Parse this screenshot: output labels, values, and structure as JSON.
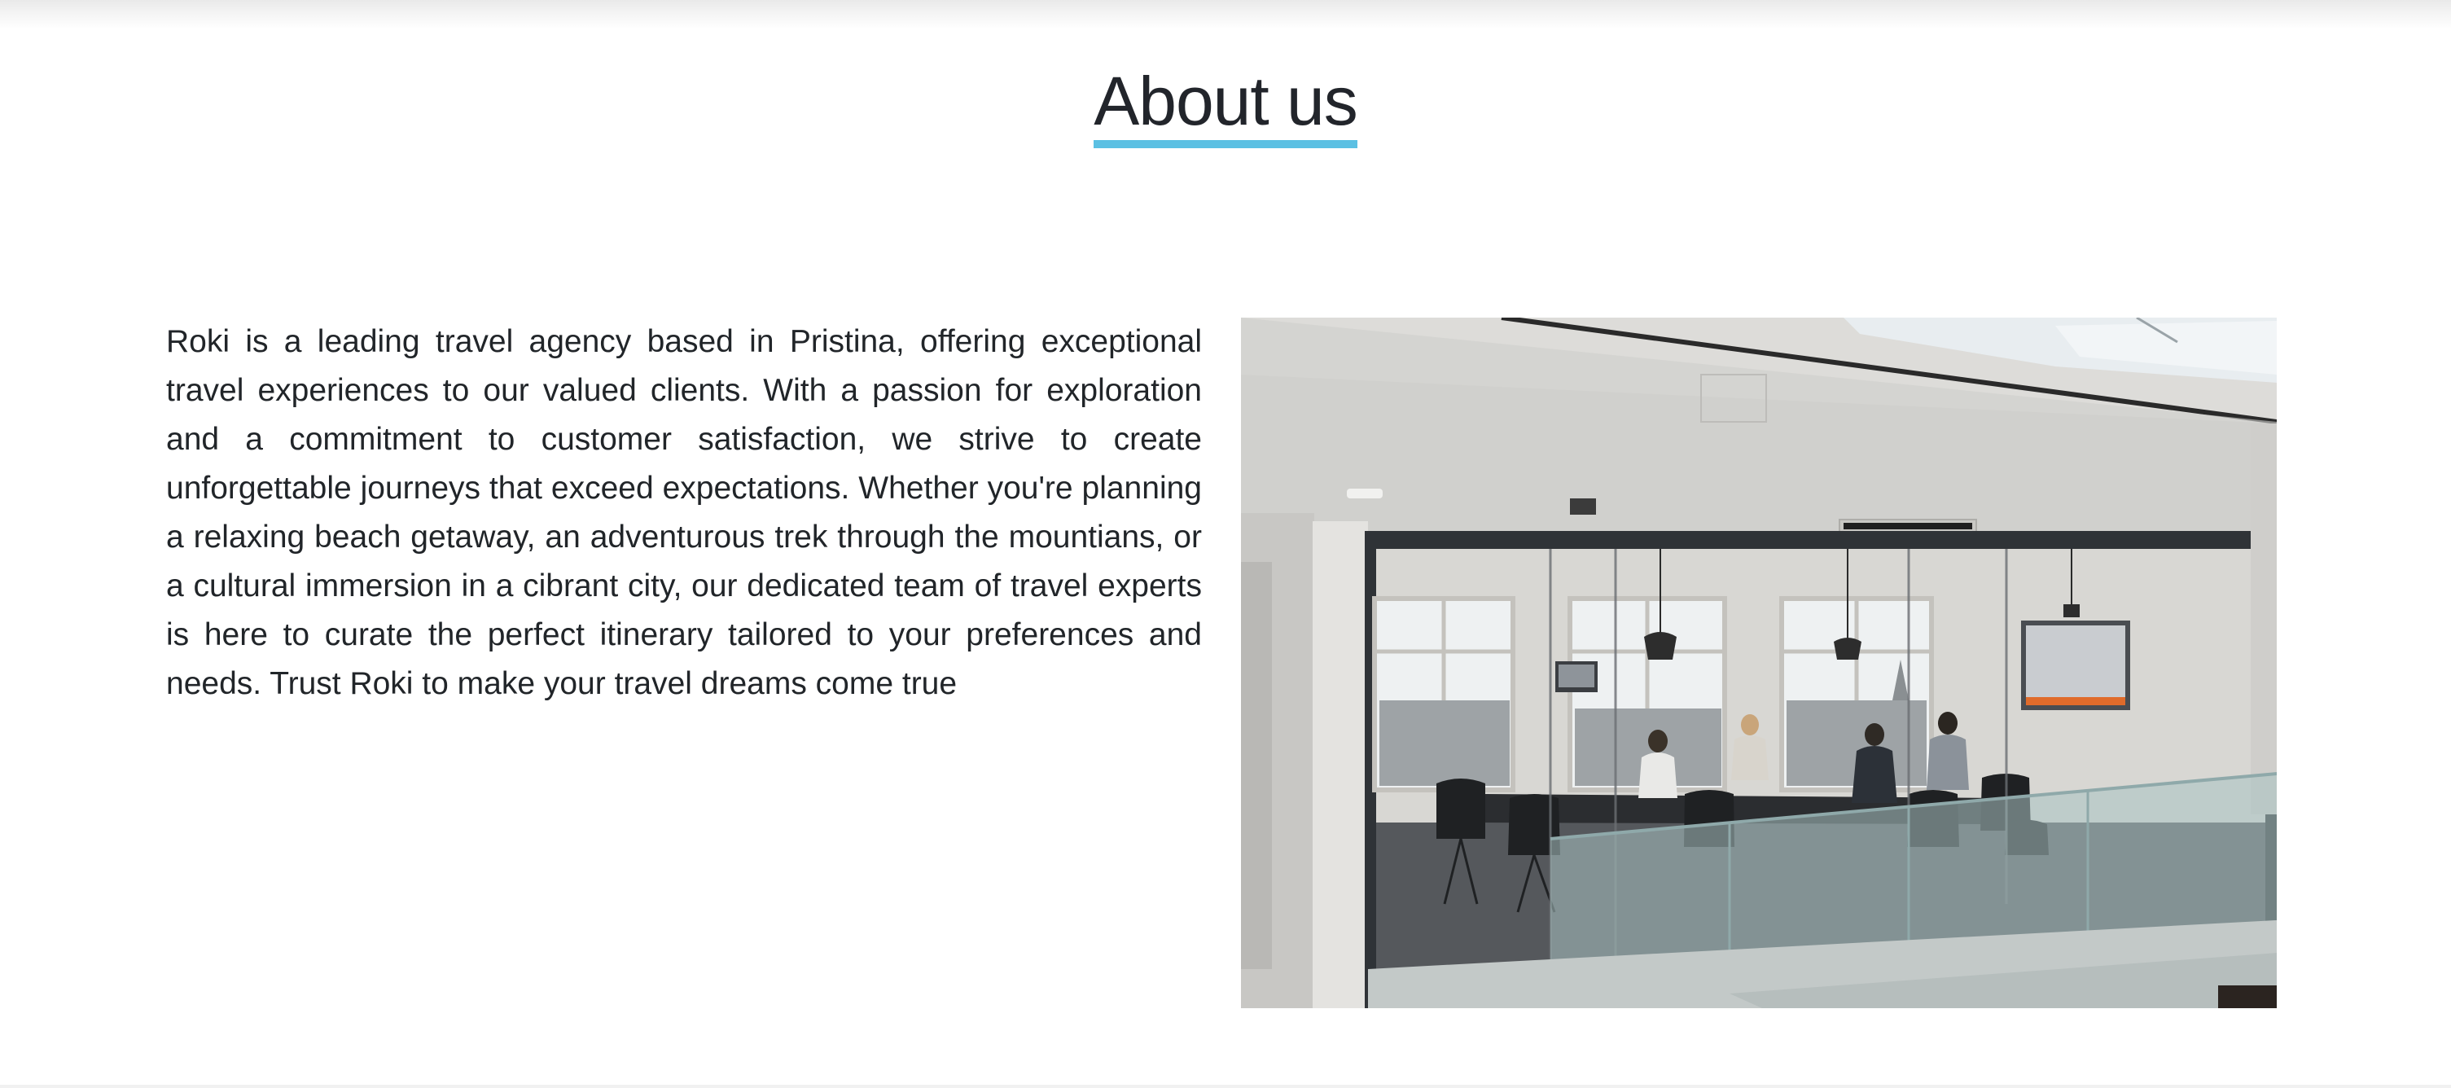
{
  "about": {
    "title": "About us",
    "paragraph": "Roki is a leading travel agency based in Pristina, offering exceptional travel experiences to our valued clients. With a passion for exploration and a commitment to customer satisfaction, we strive to create unforgettable journeys that exceed expectations. Whether you're planning a relaxing beach getaway, an adventurous trek through the mountians, or a cultural immersion in a cibrant city, our dedicated team of travel experts is here to curate the perfect itinerary tailored to your preferences and needs. Trust Roki to make your travel dreams come true"
  },
  "colors": {
    "accent": "#5bc0e3",
    "heading": "#22252b",
    "text": "#212529"
  },
  "image": {
    "subject": "office-meeting-room-photo"
  }
}
